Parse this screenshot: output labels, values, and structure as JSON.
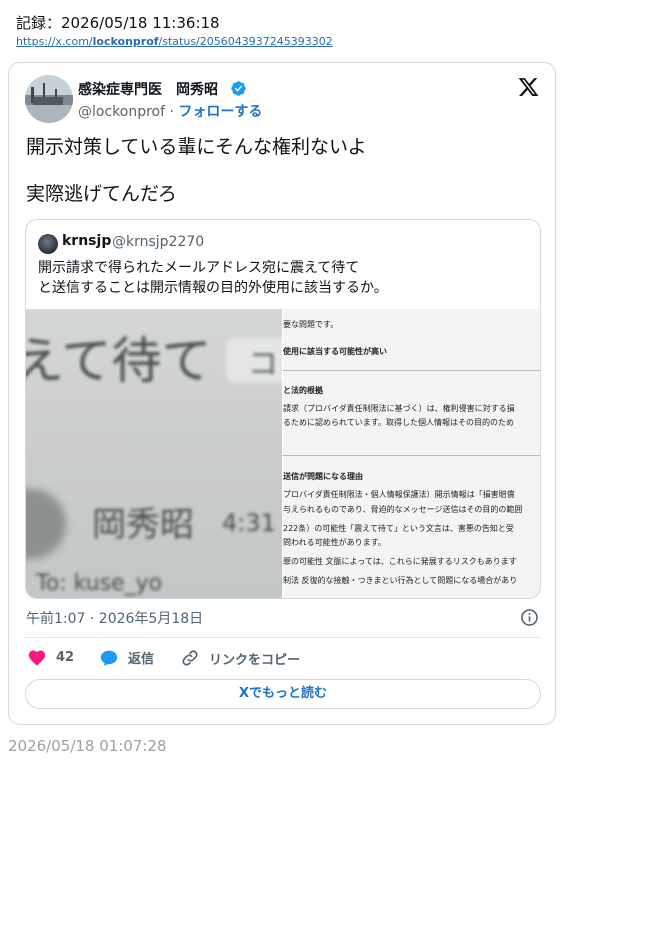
{
  "record": {
    "label": "記録：2026/05/18 11:36:18",
    "url_prefix": "https://x.com/",
    "url_user": "lockonprof",
    "url_suffix": "/status/2056043937245393302"
  },
  "tweet": {
    "display_name": "感染症専門医　岡秀昭",
    "handle": "@lockonprof",
    "separator": " · ",
    "follow_label": "フォローする",
    "text_line1": "開示対策している輩にそんな権利ないよ",
    "text_line2": "実際逃げてんだろ",
    "timestamp": "午前1:07 · 2026年5月18日",
    "likes": "42",
    "reply_label": "返信",
    "copy_link_label": "リンクをコピー",
    "read_more_label": "Xでもっと読む",
    "verified_color": "#1d9bf0",
    "link_color": "#1d74c9",
    "heart_color": "#f91880"
  },
  "quote": {
    "name": "krnsjp",
    "handle": "@krnsjp2270",
    "text_line1": "開示請求で得られたメールアドレス宛に震えて待て",
    "text_line2": "と送信することは開示情報の目的外使用に該当するか。",
    "left_image": {
      "text1": "えて待て",
      "chip": "コ",
      "text2": "岡秀昭",
      "time": "4:31",
      "to": "To: kuse_yo"
    },
    "right_image": {
      "l1": "要な問題です。",
      "l2": "使用に該当する可能性が高い",
      "l3": "と法的根拠",
      "l4": "請求（プロバイダ責任制限法に基づく）は、権利侵害に対する損",
      "l5": "るために認められています。取得した個人情報はその目的のため",
      "l6": "送信が問題になる理由",
      "l7": "プロバイダ責任制限法・個人情報保護法）開示情報は「損害賠償",
      "l8": "与えられるものであり、脅迫的なメッセージ送信はその目的の範囲",
      "l9": "222条）の可能性「震えて待て」という文言は、害悪の告知と受",
      "l10": "問われる可能性があります。",
      "l11": "罪の可能性 文脈によっては、これらに発展するリスクもあります",
      "l12": "制法 反復的な接触・つきまとい行為として問題になる場合があり"
    }
  },
  "footer_time": "2026/05/18 01:07:28"
}
